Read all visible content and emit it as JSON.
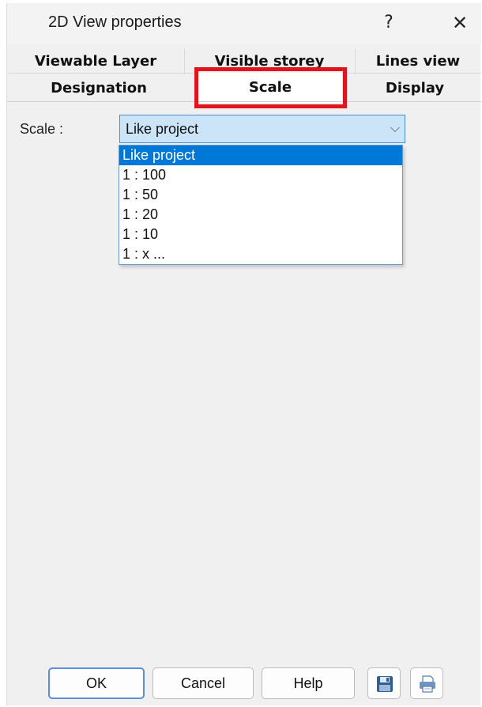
{
  "window": {
    "title": "2D View properties",
    "help_glyph": "?",
    "close_glyph": "✕"
  },
  "tabs": {
    "row1": [
      "Viewable Layer",
      "Visible storey",
      "Lines view"
    ],
    "row2": [
      "Designation",
      "Scale",
      "Display"
    ],
    "active": "Scale"
  },
  "scale": {
    "label": "Scale :",
    "selected": "Like project",
    "arrow_icon": "chevron-down-icon",
    "options": [
      "Like project",
      "1 : 100",
      "1 : 50",
      "1 : 20",
      "1 : 10",
      "1 : x ..."
    ]
  },
  "footer": {
    "ok": "OK",
    "cancel": "Cancel",
    "help": "Help",
    "save_icon": "save-icon",
    "print_icon": "print-icon"
  },
  "colors": {
    "highlight": "#e0141d",
    "selection": "#0078d7",
    "combo_bg": "#cce4f7"
  }
}
